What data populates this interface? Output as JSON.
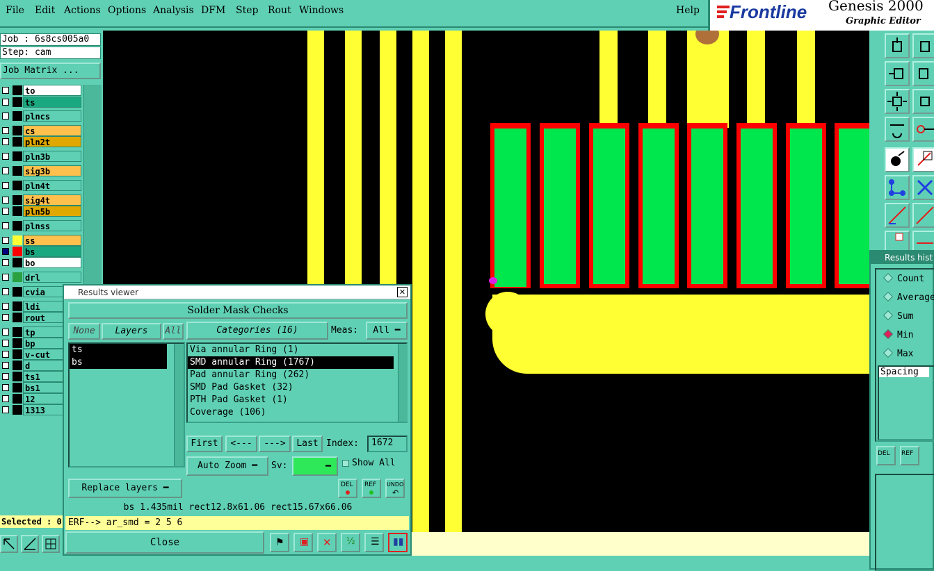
{
  "menu": {
    "items": [
      "File",
      "Edit",
      "Actions",
      "Options",
      "Analysis",
      "DFM",
      "Step",
      "Rout",
      "Windows"
    ],
    "help": "Help"
  },
  "brand": {
    "logo": "Frontline",
    "product": "Genesis 2000",
    "subtitle": "Graphic Editor"
  },
  "job": {
    "job_line": "Job : 6s8cs005a0",
    "step_line": "Step: cam",
    "matrix_button": "Job Matrix ..."
  },
  "layers": [
    {
      "name": "to",
      "color": "#ffffff"
    },
    {
      "name": "ts",
      "color": "#1aa880"
    },
    {
      "name": "plncs",
      "color": "#5fd0b4"
    },
    {
      "name": "cs",
      "color": "#ffc04d"
    },
    {
      "name": "pln2t",
      "color": "#e0a800"
    },
    {
      "name": "pln3b",
      "color": "#5fd0b4"
    },
    {
      "name": "sig3b",
      "color": "#ffc04d"
    },
    {
      "name": "pln4t",
      "color": "#5fd0b4"
    },
    {
      "name": "sig4t",
      "color": "#ffc04d"
    },
    {
      "name": "pln5b",
      "color": "#e0a800"
    },
    {
      "name": "plnss",
      "color": "#5fd0b4"
    },
    {
      "name": "ss",
      "color": "#ffc04d"
    },
    {
      "name": "bs",
      "color": "#1aa880"
    },
    {
      "name": "bo",
      "color": "#ffffff"
    },
    {
      "name": "drl",
      "color": "#5fd0b4"
    },
    {
      "name": "cvia",
      "color": "#5fd0b4"
    },
    {
      "name": "ldi",
      "color": "#5fd0b4"
    },
    {
      "name": "rout",
      "color": "#5fd0b4"
    },
    {
      "name": "tp",
      "color": "#5fd0b4"
    },
    {
      "name": "bp",
      "color": "#5fd0b4"
    },
    {
      "name": "v-cut",
      "color": "#5fd0b4"
    },
    {
      "name": "d",
      "color": "#5fd0b4"
    },
    {
      "name": "ts1",
      "color": "#5fd0b4"
    },
    {
      "name": "bs1",
      "color": "#5fd0b4"
    },
    {
      "name": "12",
      "color": "#5fd0b4"
    },
    {
      "name": "1313",
      "color": "#5fd0b4"
    }
  ],
  "selected_label": "Selected : 0",
  "results_viewer": {
    "title": "Results viewer",
    "header": "Solder Mask Checks",
    "none_btn": "None",
    "layers_btn": "Layers",
    "all_btn": "All",
    "layer_items": [
      "ts",
      "bs"
    ],
    "categories_btn": "Categories (16)",
    "meas_label": "Meas:",
    "meas_value": "All",
    "categories": [
      "Via annular Ring (1)",
      "SMD annular Ring (1767)",
      "Pad annular Ring (262)",
      "SMD Pad Gasket (32)",
      "PTH Pad Gasket (1)",
      "Coverage (106)"
    ],
    "selected_category": 1,
    "first_btn": "First",
    "prev_btn": "<---",
    "next_btn": "--->",
    "last_btn": "Last",
    "index_label": "Index:",
    "index_value": "1672",
    "auto_zoom": "Auto Zoom",
    "sv_label": "Sv:",
    "show_all": "Show All",
    "replace_layers": "Replace layers",
    "del": "DEL",
    "ref": "REF",
    "undo": "UNDO",
    "status": "bs 1.435mil  rect12.8x61.06  rect15.67x66.06",
    "erf": "ERF--> ar_smd = 2 5 6",
    "close": "Close"
  },
  "histogram": {
    "title": "Results histo",
    "options": [
      "Count",
      "Average",
      "Sum",
      "Min",
      "Max"
    ],
    "selected": 3,
    "field": "Spacing",
    "del": "DEL",
    "ref": "REF"
  }
}
